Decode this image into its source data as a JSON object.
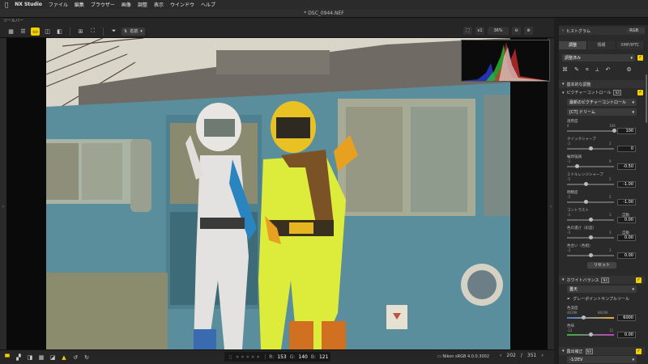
{
  "menubar": {
    "app": "NX Studio",
    "items": [
      "ファイル",
      "編集",
      "ブラウザー",
      "画像",
      "調整",
      "表示",
      "ウインドウ",
      "ヘルプ"
    ]
  },
  "window": {
    "title": "* DSC_0944.NEF"
  },
  "toolbar": {
    "label": "ツールバー",
    "sort_select": "名前",
    "zoom_fit": "x1",
    "zoom_percent": "36%"
  },
  "bottombar": {
    "rgb": {
      "r_label": "R:",
      "r": "153",
      "g_label": "G:",
      "g": "140",
      "b_label": "B:",
      "b": "121"
    },
    "stars": "★★★★★",
    "profile": "Nikon sRGB 4.0.0.3002",
    "page_current": "202",
    "page_sep": "/",
    "page_total": "351"
  },
  "panel": {
    "histogram_label": "ヒストグラム",
    "histogram_channel": "RGB",
    "tabs": [
      "調整",
      "情報",
      "XMP/IPTC"
    ],
    "preset": "調整済み",
    "basic_section": "基本的な調整",
    "picture_control": {
      "title": "ピクチャーコントロール",
      "badge": "NX",
      "mode": "最新のピクチャーコントロール",
      "preset": "[CT] ドリーム"
    },
    "sliders": [
      {
        "label": "適用度",
        "min": "0",
        "max": "100",
        "value": "100",
        "pos": 1.0
      },
      {
        "label": "クイックシャープ",
        "min": "-2",
        "max": "2",
        "value": "0",
        "pos": 0.5
      },
      {
        "label": "輪郭強調",
        "min": "-3",
        "max": "9",
        "value": "-0.50",
        "pos": 0.21
      },
      {
        "label": "ミドルレンジシャープ",
        "min": "-5",
        "max": "5",
        "value": "-1.00",
        "pos": 0.4
      },
      {
        "label": "明瞭度",
        "min": "-5",
        "max": "5",
        "value": "-1.00",
        "pos": 0.4
      },
      {
        "label": "コントラスト",
        "min": "-3",
        "max": "3",
        "value": "0.00",
        "pos": 0.5,
        "auto": "自動"
      },
      {
        "label": "色の濃さ（彩度）",
        "min": "-3",
        "max": "3",
        "value": "0.00",
        "pos": 0.5,
        "auto": "自動"
      },
      {
        "label": "色合い（色相）",
        "min": "-3",
        "max": "3",
        "value": "0.00",
        "pos": 0.5
      }
    ],
    "reset": "リセット",
    "wb": {
      "title": "ホワイトバランス",
      "badge": "NX",
      "mode": "曇天",
      "tool": "グレーポイントサンプルツール",
      "temp_label": "色温度",
      "temp_min": "4629K",
      "temp_max": "8620K",
      "temp_value": "6000",
      "temp_pos": 0.35,
      "tint_label": "色味",
      "tint_min": "-12",
      "tint_max": "12",
      "tint_value": "0.00",
      "tint_pos": 0.5
    },
    "exposure": {
      "title": "露出補正",
      "badge": "NX",
      "value": "-1/2EV"
    }
  }
}
